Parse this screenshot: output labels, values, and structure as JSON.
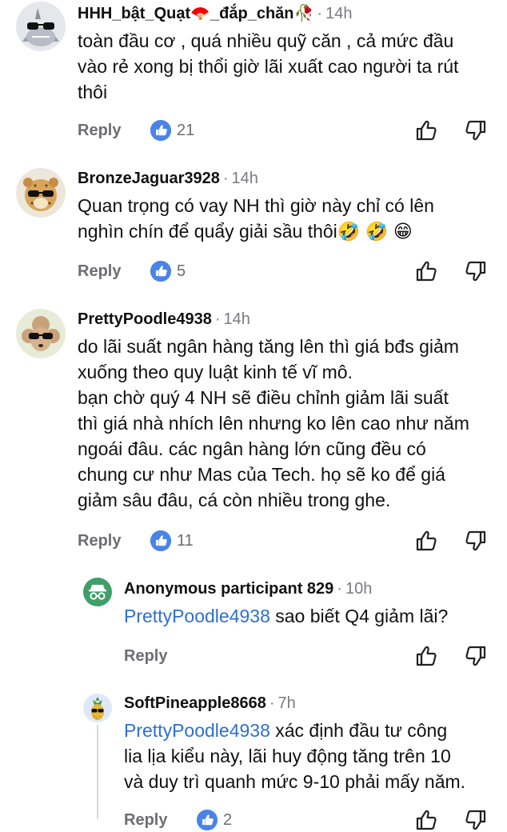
{
  "comments": [
    {
      "username": "HHH_bật_Quạt🪭_đắp_chăn🥀",
      "time": "14h",
      "text_lines": [
        "toàn đầu cơ , quá nhiều quỹ căn  , cả mức đầu",
        "vào rẻ xong bị thổi giờ lãi xuất cao người ta rút",
        "thôi"
      ],
      "reply_label": "Reply",
      "likes": "21",
      "avatar_icon": "shark-sunglasses-icon"
    },
    {
      "username": "BronzeJaguar3928",
      "time": "14h",
      "text_lines": [
        "Quan trọng có vay NH thì giờ này chỉ có lên",
        "nghìn chín để quẩy giải sầu thôi🤣 🤣 😁"
      ],
      "reply_label": "Reply",
      "likes": "5",
      "avatar_icon": "jaguar-sunglasses-icon"
    },
    {
      "username": "PrettyPoodle4938",
      "time": "14h",
      "text_lines": [
        "do lãi suất ngân hàng tăng lên thì giá bđs giảm",
        "xuống theo quy luật kinh tế vĩ mô.",
        "bạn chờ quý 4 NH sẽ điều chỉnh giảm lãi suất",
        "thì giá nhà nhích lên nhưng ko lên cao như năm",
        "ngoái đâu. các ngân hàng lớn cũng đều có",
        "chung cư như Mas của Tech. họ sẽ ko để giá",
        "giảm sâu đâu, cá còn nhiều trong ghe."
      ],
      "reply_label": "Reply",
      "likes": "11",
      "avatar_icon": "poodle-sunglasses-icon"
    }
  ],
  "replies": [
    {
      "username": "Anonymous participant 829",
      "time": "10h",
      "mention": "PrettyPoodle4938",
      "text_lines": [
        " sao biết Q4 giảm lãi?"
      ],
      "reply_label": "Reply",
      "avatar_icon": "anonymous-spy-icon"
    },
    {
      "username": "SoftPineapple8668",
      "time": "7h",
      "mention": "PrettyPoodle4938",
      "text_lines": [
        " xác định đầu tư công",
        "lia lịa kiểu này, lãi huy động tăng trên 10",
        "và duy trì quanh mức 9-10 phải mấy năm."
      ],
      "reply_label": "Reply",
      "likes": "2",
      "avatar_icon": "pineapple-sunglasses-icon"
    }
  ],
  "separator": "·",
  "colors": {
    "mention": "#2f6fcf",
    "like_badge": "#4a84e8",
    "meta": "#7a7a80",
    "anon_avatar": "#3f9e6a"
  }
}
